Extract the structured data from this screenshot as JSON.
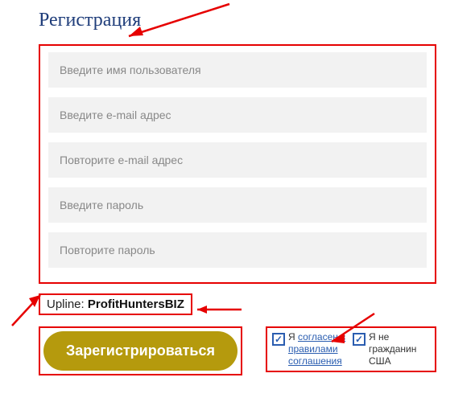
{
  "title": "Регистрация",
  "form": {
    "username_placeholder": "Введите имя пользователя",
    "email_placeholder": "Введите e-mail адрес",
    "email_confirm_placeholder": "Повторите e-mail адрес",
    "password_placeholder": "Введите пароль",
    "password_confirm_placeholder": "Повторите пароль"
  },
  "upline": {
    "label": "Upline: ",
    "value": "ProfitHuntersBIZ"
  },
  "submit_label": "Зарегистрироваться",
  "checks": {
    "agree_prefix": "Я ",
    "agree_link": "согласен с правилами соглашения",
    "not_us": "Я не гражданин США"
  }
}
